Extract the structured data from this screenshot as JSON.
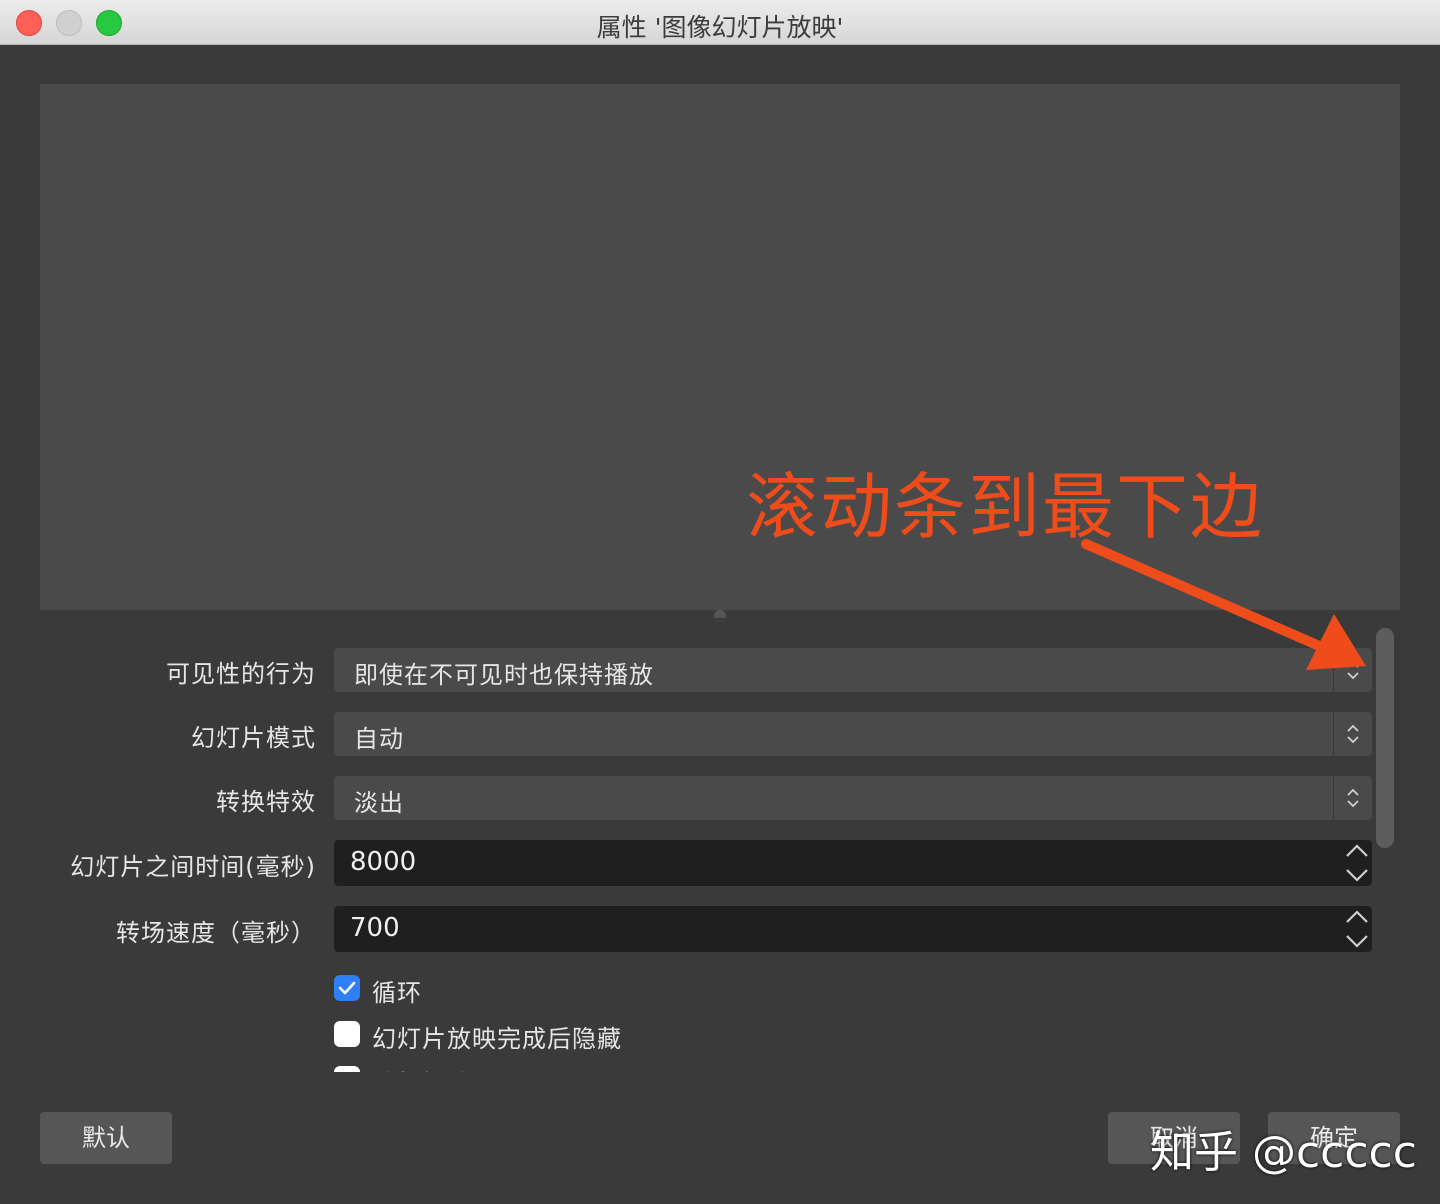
{
  "window": {
    "title": "属性 '图像幻灯片放映'"
  },
  "form": {
    "visibility": {
      "label": "可见性的行为",
      "value": "即使在不可见时也保持播放"
    },
    "mode": {
      "label": "幻灯片模式",
      "value": "自动"
    },
    "transition": {
      "label": "转换特效",
      "value": "淡出"
    },
    "slide_time": {
      "label": "幻灯片之间时间(毫秒)",
      "value": "8000"
    },
    "transition_speed": {
      "label": "转场速度（毫秒）",
      "value": "700"
    },
    "loop": {
      "label": "循环",
      "checked": true
    },
    "hide_when_done": {
      "label": "幻灯片放映完成后隐藏",
      "checked": false
    },
    "random": {
      "label": "随机播放",
      "checked": false
    }
  },
  "buttons": {
    "defaults": "默认",
    "cancel": "取消",
    "ok": "确定"
  },
  "annotation": {
    "text": "滚动条到最下边",
    "color": "#ee4c1a"
  },
  "watermark": {
    "text": "知乎 @ccccc"
  },
  "colors": {
    "checkbox_accent": "#2f7ff6",
    "background": "#3a3a3a"
  }
}
